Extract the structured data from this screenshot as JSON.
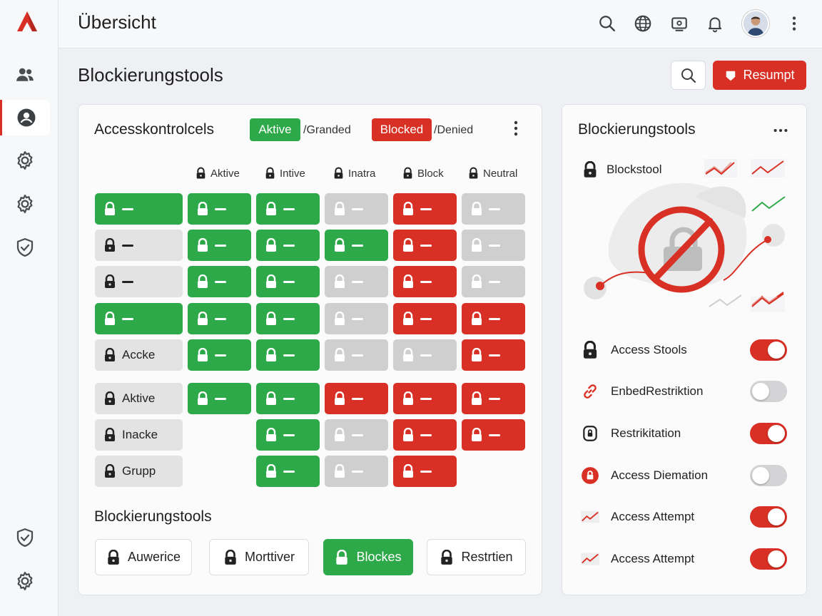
{
  "header": {
    "title": "Übersicht",
    "icons": [
      "search-icon",
      "globe-icon",
      "screen-share-icon",
      "bell-icon",
      "more-vertical-icon"
    ]
  },
  "sidebar": {
    "items": [
      {
        "name": "users-icon"
      },
      {
        "name": "user-circle-icon",
        "active": true
      },
      {
        "name": "settings-icon"
      },
      {
        "name": "settings-icon"
      },
      {
        "name": "shield-check-icon"
      },
      {
        "name": "shield-check-icon"
      },
      {
        "name": "settings-icon"
      }
    ]
  },
  "page": {
    "title": "Blockierungstools",
    "resume_label": "Resumpt"
  },
  "access_card": {
    "title": "Accesskontrolcels",
    "legend": [
      {
        "pill": "Aktive",
        "text": "/Granded",
        "color": "#2ea94a"
      },
      {
        "pill": "Blocked",
        "text": "/Denied",
        "color": "#d93025"
      }
    ],
    "columns": [
      "Aktive",
      "Intive",
      "Inatra",
      "Block",
      "Neutral"
    ],
    "rows": [
      {
        "label": "",
        "first": "green",
        "cells": [
          "green",
          "green",
          "gray",
          "red",
          "gray"
        ]
      },
      {
        "label": "",
        "first": "light",
        "cells": [
          "green",
          "green",
          "green",
          "red",
          "gray"
        ]
      },
      {
        "label": "",
        "first": "light",
        "cells": [
          "green",
          "green",
          "gray",
          "red",
          "gray"
        ]
      },
      {
        "label": "",
        "first": "green",
        "cells": [
          "green",
          "green",
          "gray",
          "red",
          "red"
        ]
      },
      {
        "label": "Accke",
        "first": "light",
        "cells": [
          "green",
          "green",
          "gray",
          "gray",
          "red"
        ]
      },
      {
        "label": "Aktive",
        "first": "light",
        "cells": [
          "green",
          "green",
          "red",
          "red",
          "red"
        ]
      },
      {
        "label": "Inacke",
        "first": "light",
        "cells": [
          "",
          "green",
          "gray",
          "red",
          "red"
        ]
      },
      {
        "label": "Grupp",
        "first": "light",
        "cells": [
          "",
          "green",
          "gray",
          "red",
          ""
        ]
      }
    ],
    "section_title": "Blockierungstools",
    "buttons": [
      {
        "label": "Auwerice",
        "active": false
      },
      {
        "label": "Morttiver",
        "active": false
      },
      {
        "label": "Blockes",
        "active": true
      },
      {
        "label": "Restrtien",
        "active": false
      }
    ]
  },
  "tools_card": {
    "title": "Blockierungstools",
    "subtitle": "Blockstool",
    "items": [
      {
        "label": "Access Stools",
        "icon": "lock-icon",
        "on": true
      },
      {
        "label": "EnbedRestriktion",
        "icon": "link-icon",
        "on": false
      },
      {
        "label": "Restrikitation",
        "icon": "shield-lock-icon",
        "on": true
      },
      {
        "label": "Access Diemation",
        "icon": "alert-lock-icon",
        "on": false
      },
      {
        "label": "Access Attempt",
        "icon": "trend-icon",
        "on": true
      },
      {
        "label": "Access Attempt",
        "icon": "trend-icon",
        "on": true
      }
    ]
  },
  "colors": {
    "accent": "#d93025",
    "granted": "#2ea94a",
    "neutral": "#cfcfcf"
  }
}
